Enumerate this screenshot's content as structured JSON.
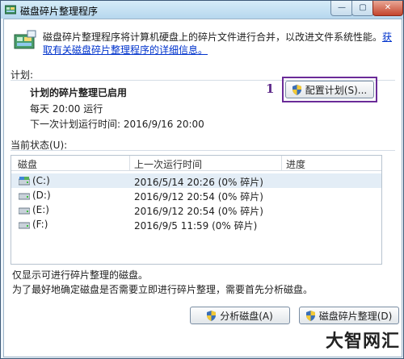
{
  "window": {
    "title": "磁盘碎片整理程序",
    "controls": {
      "minimize": "—",
      "maximize": "▢",
      "close": "✕"
    }
  },
  "intro": {
    "text": "磁盘碎片整理程序将计算机硬盘上的碎片文件进行合并，以改进文件系统性能。",
    "link": "获取有关磁盘碎片整理程序的详细信息。"
  },
  "schedule": {
    "section_label": "计划:",
    "status": "计划的碎片整理已启用",
    "frequency": "每天 20:00 运行",
    "next_run": "下一次计划运行时间: 2016/9/16 20:00",
    "configure_button": "配置计划(S)...",
    "annotation": "1"
  },
  "current_status": {
    "section_label": "当前状态(U):",
    "columns": [
      "磁盘",
      "上一次运行时间",
      "进度"
    ],
    "disks": [
      {
        "name": "(C:)",
        "last_run": "2016/5/14 20:26 (0% 碎片)",
        "progress": ""
      },
      {
        "name": "(D:)",
        "last_run": "2016/9/12 20:54 (0% 碎片)",
        "progress": ""
      },
      {
        "name": "(E:)",
        "last_run": "2016/9/12 20:54 (0% 碎片)",
        "progress": ""
      },
      {
        "name": "(F:)",
        "last_run": "2016/9/5 11:59 (0% 碎片)",
        "progress": ""
      }
    ]
  },
  "footer": {
    "note1": "仅显示可进行碎片整理的磁盘。",
    "note2": "为了最好地确定磁盘是否需要立即进行碎片整理，需要首先分析磁盘。",
    "analyze_button": "分析磁盘(A)",
    "defrag_button": "磁盘碎片整理(D)"
  },
  "watermark": "大智网汇",
  "colors": {
    "annotation": "#6a2b98",
    "link": "#0033cc",
    "selection": "#e3edf6"
  }
}
